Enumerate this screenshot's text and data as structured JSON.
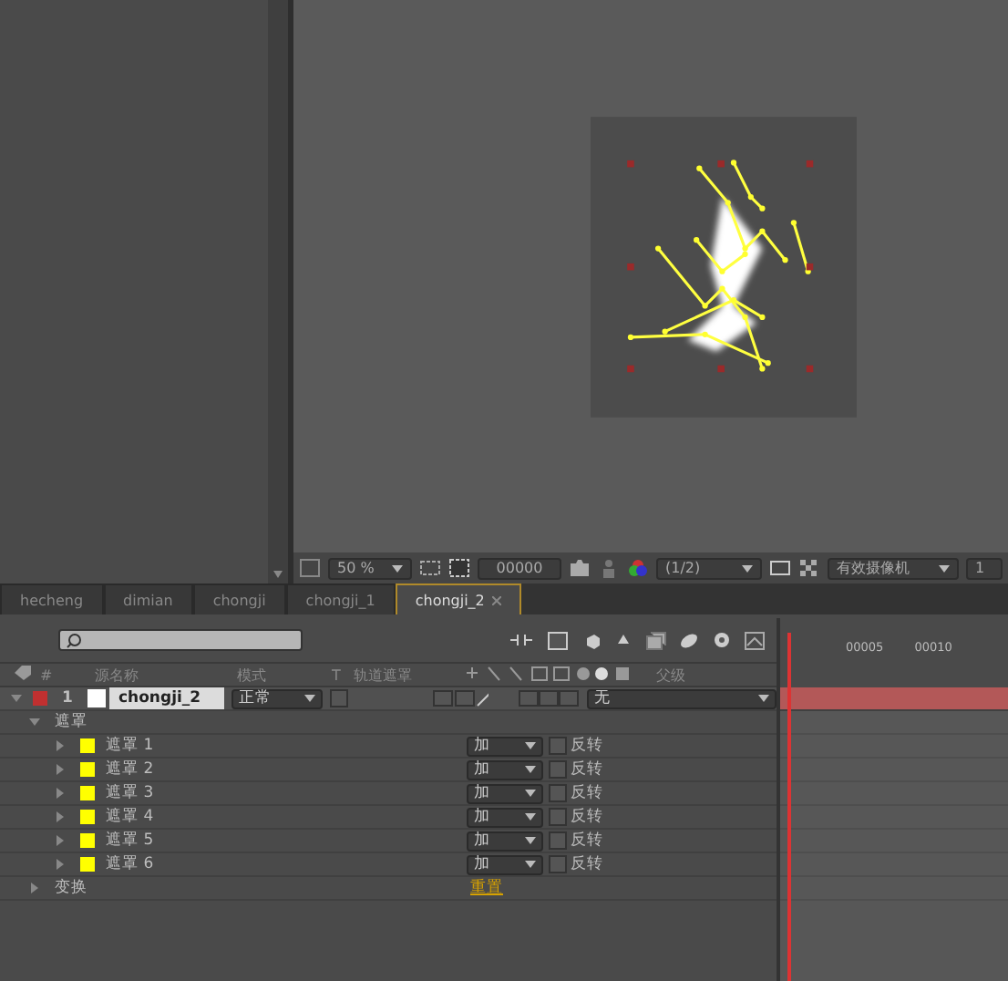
{
  "viewer": {
    "zoom": "50 %",
    "timecode": "00000",
    "resolution": "(1/2)",
    "camera": "有效摄像机",
    "view": "1"
  },
  "tabs": [
    {
      "label": "hecheng",
      "selected": false
    },
    {
      "label": "dimian",
      "selected": false
    },
    {
      "label": "chongji",
      "selected": false
    },
    {
      "label": "chongji_1",
      "selected": false
    },
    {
      "label": "chongji_2",
      "selected": true
    }
  ],
  "columns": [
    "#",
    "源名称",
    "模式",
    "T",
    "轨道遮罩",
    "父级"
  ],
  "ruler": [
    "00005",
    "00010"
  ],
  "layer": {
    "number": "1",
    "name": "chongji_2",
    "mode": "正常",
    "parent": "无",
    "expanded": true,
    "preserve_transparency": false
  },
  "groups": [
    {
      "label": "遮罩",
      "expanded": true,
      "children": [
        {
          "label": "遮罩 1",
          "mode": "加",
          "invert_label": "反转",
          "inverted": false
        },
        {
          "label": "遮罩 2",
          "mode": "加",
          "invert_label": "反转",
          "inverted": false
        },
        {
          "label": "遮罩 3",
          "mode": "加",
          "invert_label": "反转",
          "inverted": false
        },
        {
          "label": "遮罩 4",
          "mode": "加",
          "invert_label": "反转",
          "inverted": false
        },
        {
          "label": "遮罩 5",
          "mode": "加",
          "invert_label": "反转",
          "inverted": false
        },
        {
          "label": "遮罩 6",
          "mode": "加",
          "invert_label": "反转",
          "inverted": false
        }
      ]
    },
    {
      "label": "变换",
      "expanded": false,
      "action": "重置"
    }
  ]
}
